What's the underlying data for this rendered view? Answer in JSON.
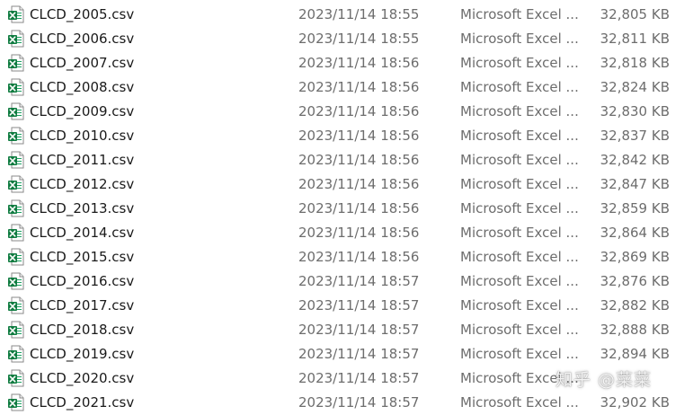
{
  "files": [
    {
      "name": "CLCD_2005.csv",
      "date": "2023/11/14 18:55",
      "type": "Microsoft Excel ...",
      "size": "32,805 KB",
      "icon": "excel-csv-icon"
    },
    {
      "name": "CLCD_2006.csv",
      "date": "2023/11/14 18:55",
      "type": "Microsoft Excel ...",
      "size": "32,811 KB",
      "icon": "excel-csv-icon"
    },
    {
      "name": "CLCD_2007.csv",
      "date": "2023/11/14 18:56",
      "type": "Microsoft Excel ...",
      "size": "32,818 KB",
      "icon": "excel-csv-icon"
    },
    {
      "name": "CLCD_2008.csv",
      "date": "2023/11/14 18:56",
      "type": "Microsoft Excel ...",
      "size": "32,824 KB",
      "icon": "excel-csv-icon"
    },
    {
      "name": "CLCD_2009.csv",
      "date": "2023/11/14 18:56",
      "type": "Microsoft Excel ...",
      "size": "32,830 KB",
      "icon": "excel-csv-icon"
    },
    {
      "name": "CLCD_2010.csv",
      "date": "2023/11/14 18:56",
      "type": "Microsoft Excel ...",
      "size": "32,837 KB",
      "icon": "excel-csv-icon"
    },
    {
      "name": "CLCD_2011.csv",
      "date": "2023/11/14 18:56",
      "type": "Microsoft Excel ...",
      "size": "32,842 KB",
      "icon": "excel-csv-icon"
    },
    {
      "name": "CLCD_2012.csv",
      "date": "2023/11/14 18:56",
      "type": "Microsoft Excel ...",
      "size": "32,847 KB",
      "icon": "excel-csv-icon"
    },
    {
      "name": "CLCD_2013.csv",
      "date": "2023/11/14 18:56",
      "type": "Microsoft Excel ...",
      "size": "32,859 KB",
      "icon": "excel-csv-icon"
    },
    {
      "name": "CLCD_2014.csv",
      "date": "2023/11/14 18:56",
      "type": "Microsoft Excel ...",
      "size": "32,864 KB",
      "icon": "excel-csv-icon"
    },
    {
      "name": "CLCD_2015.csv",
      "date": "2023/11/14 18:56",
      "type": "Microsoft Excel ...",
      "size": "32,869 KB",
      "icon": "excel-csv-icon"
    },
    {
      "name": "CLCD_2016.csv",
      "date": "2023/11/14 18:57",
      "type": "Microsoft Excel ...",
      "size": "32,876 KB",
      "icon": "excel-csv-icon"
    },
    {
      "name": "CLCD_2017.csv",
      "date": "2023/11/14 18:57",
      "type": "Microsoft Excel ...",
      "size": "32,882 KB",
      "icon": "excel-csv-icon"
    },
    {
      "name": "CLCD_2018.csv",
      "date": "2023/11/14 18:57",
      "type": "Microsoft Excel ...",
      "size": "32,888 KB",
      "icon": "excel-csv-icon"
    },
    {
      "name": "CLCD_2019.csv",
      "date": "2023/11/14 18:57",
      "type": "Microsoft Excel ...",
      "size": "32,894 KB",
      "icon": "excel-csv-icon"
    },
    {
      "name": "CLCD_2020.csv",
      "date": "2023/11/14 18:57",
      "type": "Microsoft Excel ...",
      "size": "",
      "icon": "excel-csv-icon"
    },
    {
      "name": "CLCD_2021.csv",
      "date": "2023/11/14 18:57",
      "type": "Microsoft Excel ...",
      "size": "32,902 KB",
      "icon": "excel-csv-icon"
    }
  ],
  "watermark": "知乎 @菜菜",
  "colors": {
    "excel_green": "#21a366",
    "excel_dark_green": "#107c41",
    "name_text": "#1a1a1a",
    "meta_text": "#6d6d6d"
  }
}
